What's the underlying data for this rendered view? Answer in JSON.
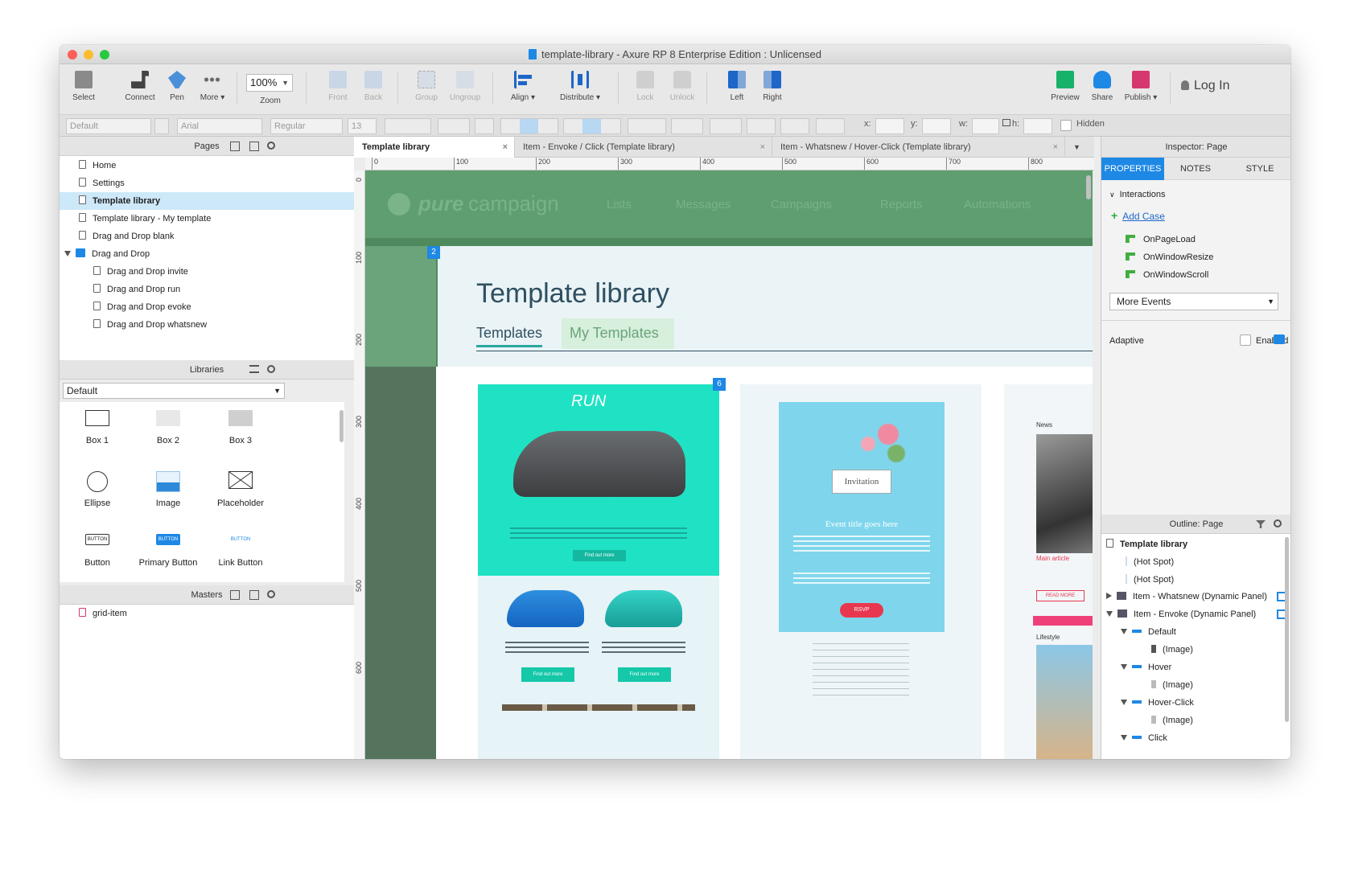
{
  "window": {
    "title": "template-library - Axure RP 8 Enterprise Edition : Unlicensed"
  },
  "toolbar": {
    "select": "Select",
    "connect": "Connect",
    "pen": "Pen",
    "more": "More ▾",
    "zoom_value": "100%",
    "zoom": "Zoom",
    "front": "Front",
    "back": "Back",
    "group": "Group",
    "ungroup": "Ungroup",
    "align": "Align ▾",
    "distribute": "Distribute ▾",
    "lock": "Lock",
    "unlock": "Unlock",
    "left": "Left",
    "right": "Right",
    "preview": "Preview",
    "share": "Share",
    "publish": "Publish ▾",
    "login": "Log In"
  },
  "format": {
    "style": "Default",
    "font": "Arial",
    "weight": "Regular",
    "size": "13",
    "x": "x:",
    "y": "y:",
    "w": "w:",
    "h": "h:",
    "hidden": "Hidden"
  },
  "pages": {
    "title": "Pages",
    "items": [
      "Home",
      "Settings",
      "Template library",
      "Template library - My template",
      "Drag and Drop blank",
      "Drag and Drop",
      "Drag and Drop invite",
      "Drag and Drop run",
      "Drag and Drop evoke",
      "Drag and Drop whatsnew"
    ]
  },
  "libraries": {
    "title": "Libraries",
    "selected": "Default",
    "widgets": [
      "Box 1",
      "Box 2",
      "Box 3",
      "Ellipse",
      "Image",
      "Placeholder",
      "Button",
      "Primary Button",
      "Link Button"
    ],
    "button_text": "BUTTON"
  },
  "masters": {
    "title": "Masters",
    "items": [
      "grid-item"
    ]
  },
  "tabs": [
    "Template library",
    "Item - Envoke / Click (Template library)",
    "Item - Whatsnew / Hover-Click (Template library)"
  ],
  "ruler": {
    "h": [
      "0",
      "100",
      "200",
      "300",
      "400",
      "500",
      "600",
      "700",
      "800"
    ],
    "v": [
      "0",
      "100",
      "200",
      "300",
      "400",
      "500",
      "600"
    ]
  },
  "canvas": {
    "brand_a": "pure",
    "brand_b": "campaign",
    "nav": [
      "Lists",
      "Messages",
      "Campaigns",
      "Reports",
      "Automations"
    ],
    "badge1": "2",
    "badge2": "6",
    "heading": "Template library",
    "tab1": "Templates",
    "tab2": "My Templates",
    "run_logo": "RUN",
    "find_out": "Find out more",
    "invitation": "Invitation",
    "event_title": "Event title goes here",
    "rsvp": "RSVP",
    "news": "News",
    "main_article": "Main article",
    "read_more": "READ MORE",
    "lifestyle": "Lifestyle"
  },
  "inspector": {
    "title": "Inspector: Page",
    "tabs": [
      "PROPERTIES",
      "NOTES",
      "STYLE"
    ],
    "interactions": "Interactions",
    "add_case": "Add Case",
    "events": [
      "OnPageLoad",
      "OnWindowResize",
      "OnWindowScroll"
    ],
    "more_events": "More Events",
    "adaptive": "Adaptive",
    "enabled": "Enabled"
  },
  "outline": {
    "title": "Outline: Page",
    "items": [
      "Template library",
      "(Hot Spot)",
      "(Hot Spot)",
      "Item - Whatsnew (Dynamic Panel)",
      "Item - Envoke (Dynamic Panel)",
      "Default",
      "(Image)",
      "Hover",
      "(Image)",
      "Hover-Click",
      "(Image)",
      "Click"
    ]
  },
  "colors": {
    "accent": "#1e88e5",
    "brand_green": "#5c9b6e",
    "teal": "#00e0c0",
    "invite_blue": "#7fd7ec",
    "rsvp": "#e8384f"
  }
}
